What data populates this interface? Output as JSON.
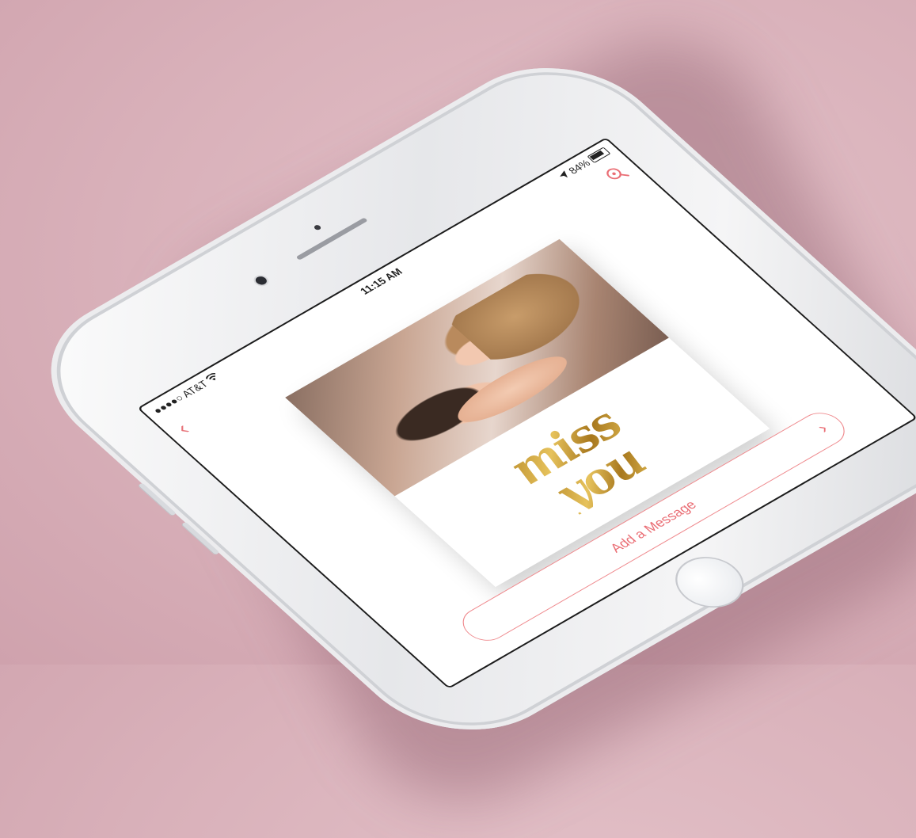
{
  "status_bar": {
    "carrier": "●●●●○ AT&T",
    "wifi_icon": "wifi-icon",
    "time": "11:15 AM",
    "location_icon": "location-arrow-icon",
    "battery_percent": "84%",
    "battery_level": 0.84
  },
  "nav": {
    "back_icon": "chevron-left-icon",
    "zoom_icon": "zoom-in-icon"
  },
  "card": {
    "line1": "miss",
    "line2": "you"
  },
  "cta": {
    "label": "Add a Message",
    "chevron_icon": "chevron-right-icon"
  },
  "colors": {
    "accent": "#ea6e75",
    "background": "#d9b1ba",
    "gold": "#c9a03b"
  }
}
